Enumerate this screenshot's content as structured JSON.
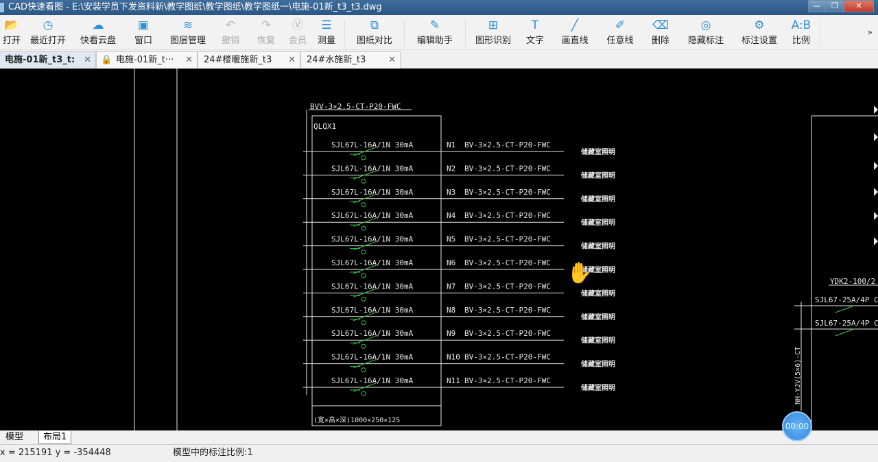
{
  "window": {
    "title": "CAD快速看图 - E:\\安装学员下发资料新\\教学图纸\\教学图纸\\教学图纸一\\电施-01新_t3_t3.dwg"
  },
  "toolbar": [
    {
      "label": "打开",
      "icon": "folder-icon",
      "w": 34,
      "dis": false,
      "g": "📂"
    },
    {
      "label": "最近打开",
      "icon": "clock-icon",
      "w": 72,
      "dis": false,
      "g": "◷"
    },
    {
      "label": "快看云盘",
      "icon": "cloud-icon",
      "w": 74,
      "dis": false,
      "g": "☁"
    },
    {
      "label": "窗口",
      "icon": "window-icon",
      "w": 58,
      "dis": false,
      "g": "▣"
    },
    {
      "label": "图层管理",
      "icon": "layers-icon",
      "w": 72,
      "dis": false,
      "g": "≋"
    },
    {
      "sep": true
    },
    {
      "label": "撤销",
      "icon": "undo-icon",
      "w": 52,
      "dis": true,
      "g": "↶"
    },
    {
      "label": "恢复",
      "icon": "redo-icon",
      "w": 52,
      "dis": true,
      "g": "↷"
    },
    {
      "label": "会员",
      "icon": "vip-icon",
      "w": 40,
      "dis": true,
      "g": "Ⓥ"
    },
    {
      "label": "测量",
      "icon": "measure-icon",
      "w": 44,
      "dis": false,
      "g": "☰"
    },
    {
      "sep": true
    },
    {
      "label": "图纸对比",
      "icon": "compare-icon",
      "w": 78,
      "dis": false,
      "g": "⧉"
    },
    {
      "sep": true
    },
    {
      "label": "编辑助手",
      "icon": "edit-icon",
      "w": 80,
      "dis": false,
      "g": "✎"
    },
    {
      "sep": true
    },
    {
      "label": "图形识别",
      "icon": "shape-recognize-icon",
      "w": 72,
      "dis": false,
      "g": "⊞"
    },
    {
      "label": "文字",
      "icon": "text-icon",
      "w": 50,
      "dis": false,
      "g": "T"
    },
    {
      "label": "画直线",
      "icon": "line-icon",
      "w": 66,
      "dis": false,
      "g": "╱"
    },
    {
      "label": "任意线",
      "icon": "pen-icon",
      "w": 66,
      "dis": false,
      "g": "✐"
    },
    {
      "label": "删除",
      "icon": "eraser-icon",
      "w": 52,
      "dis": false,
      "g": "⌫"
    },
    {
      "label": "隐藏标注",
      "icon": "eye-hide-icon",
      "w": 80,
      "dis": false,
      "g": "◎"
    },
    {
      "label": "标注设置",
      "icon": "annotation-settings-icon",
      "w": 76,
      "dis": false,
      "g": "⚙"
    },
    {
      "label": "比例",
      "icon": "scale-icon",
      "w": 46,
      "dis": false,
      "g": "A:B"
    }
  ],
  "overflow": "»",
  "tabs": [
    {
      "label": "电施-01新_t3_t:",
      "active": true,
      "lock": false
    },
    {
      "label": "电施-01新_t···",
      "active": false,
      "lock": true
    },
    {
      "label": "24#楼暖施新_t3",
      "active": false,
      "lock": false
    },
    {
      "label": "24#水施新_t3",
      "active": false,
      "lock": false
    }
  ],
  "drawing": {
    "feeder_label": "BVV-3×2.5-CT-P20-FWC",
    "panel_name": "QLQX1",
    "box_size": "(宽×高×深)1000×250×125",
    "circuits": [
      {
        "breaker": "SJL67L-16A/1N 30mA",
        "id": "N1",
        "cable": "BV-3×2.5-CT-P20-FWC",
        "use": "储藏室照明"
      },
      {
        "breaker": "SJL67L-16A/1N 30mA",
        "id": "N2",
        "cable": "BV-3×2.5-CT-P20-FWC",
        "use": "储藏室照明"
      },
      {
        "breaker": "SJL67L-16A/1N 30mA",
        "id": "N3",
        "cable": "BV-3×2.5-CT-P20-FWC",
        "use": "储藏室照明"
      },
      {
        "breaker": "SJL67L-16A/1N 30mA",
        "id": "N4",
        "cable": "BV-3×2.5-CT-P20-FWC",
        "use": "储藏室照明"
      },
      {
        "breaker": "SJL67L-16A/1N 30mA",
        "id": "N5",
        "cable": "BV-3×2.5-CT-P20-FWC",
        "use": "储藏室照明"
      },
      {
        "breaker": "SJL67L-16A/1N 30mA",
        "id": "N6",
        "cable": "BV-3×2.5-CT-P20-FWC",
        "use": "储藏室照明"
      },
      {
        "breaker": "SJL67L-16A/1N 30mA",
        "id": "N7",
        "cable": "BV-3×2.5-CT-P20-FWC",
        "use": "储藏室照明"
      },
      {
        "breaker": "SJL67L-16A/1N 30mA",
        "id": "N8",
        "cable": "BV-3×2.5-CT-P20-FWC",
        "use": "储藏室照明"
      },
      {
        "breaker": "SJL67L-16A/1N 30mA",
        "id": "N9",
        "cable": "BV-3×2.5-CT-P20-FWC",
        "use": "储藏室照明"
      },
      {
        "breaker": "SJL67L-16A/1N 30mA",
        "id": "N10",
        "cable": "BV-3×2.5-CT-P20-FWC",
        "use": "储藏室照明"
      },
      {
        "breaker": "SJL67L-16A/1N 30mA",
        "id": "N11",
        "cable": "BV-3×2.5-CT-P20-FWC",
        "use": "储藏室照明"
      }
    ],
    "right_panel": {
      "main_breaker": "YDK2-100/2",
      "breakers": [
        "SJL67-25A/4P C",
        "SJL67-25A/4P C"
      ],
      "feeder": "NH-YJV(5×6)-CT"
    }
  },
  "sheets": {
    "model": "模型",
    "layout1": "布局1"
  },
  "status": {
    "coords": "x = 215191 y = -354448",
    "scale": "模型中的标注比例:1"
  },
  "timer": "00:00"
}
